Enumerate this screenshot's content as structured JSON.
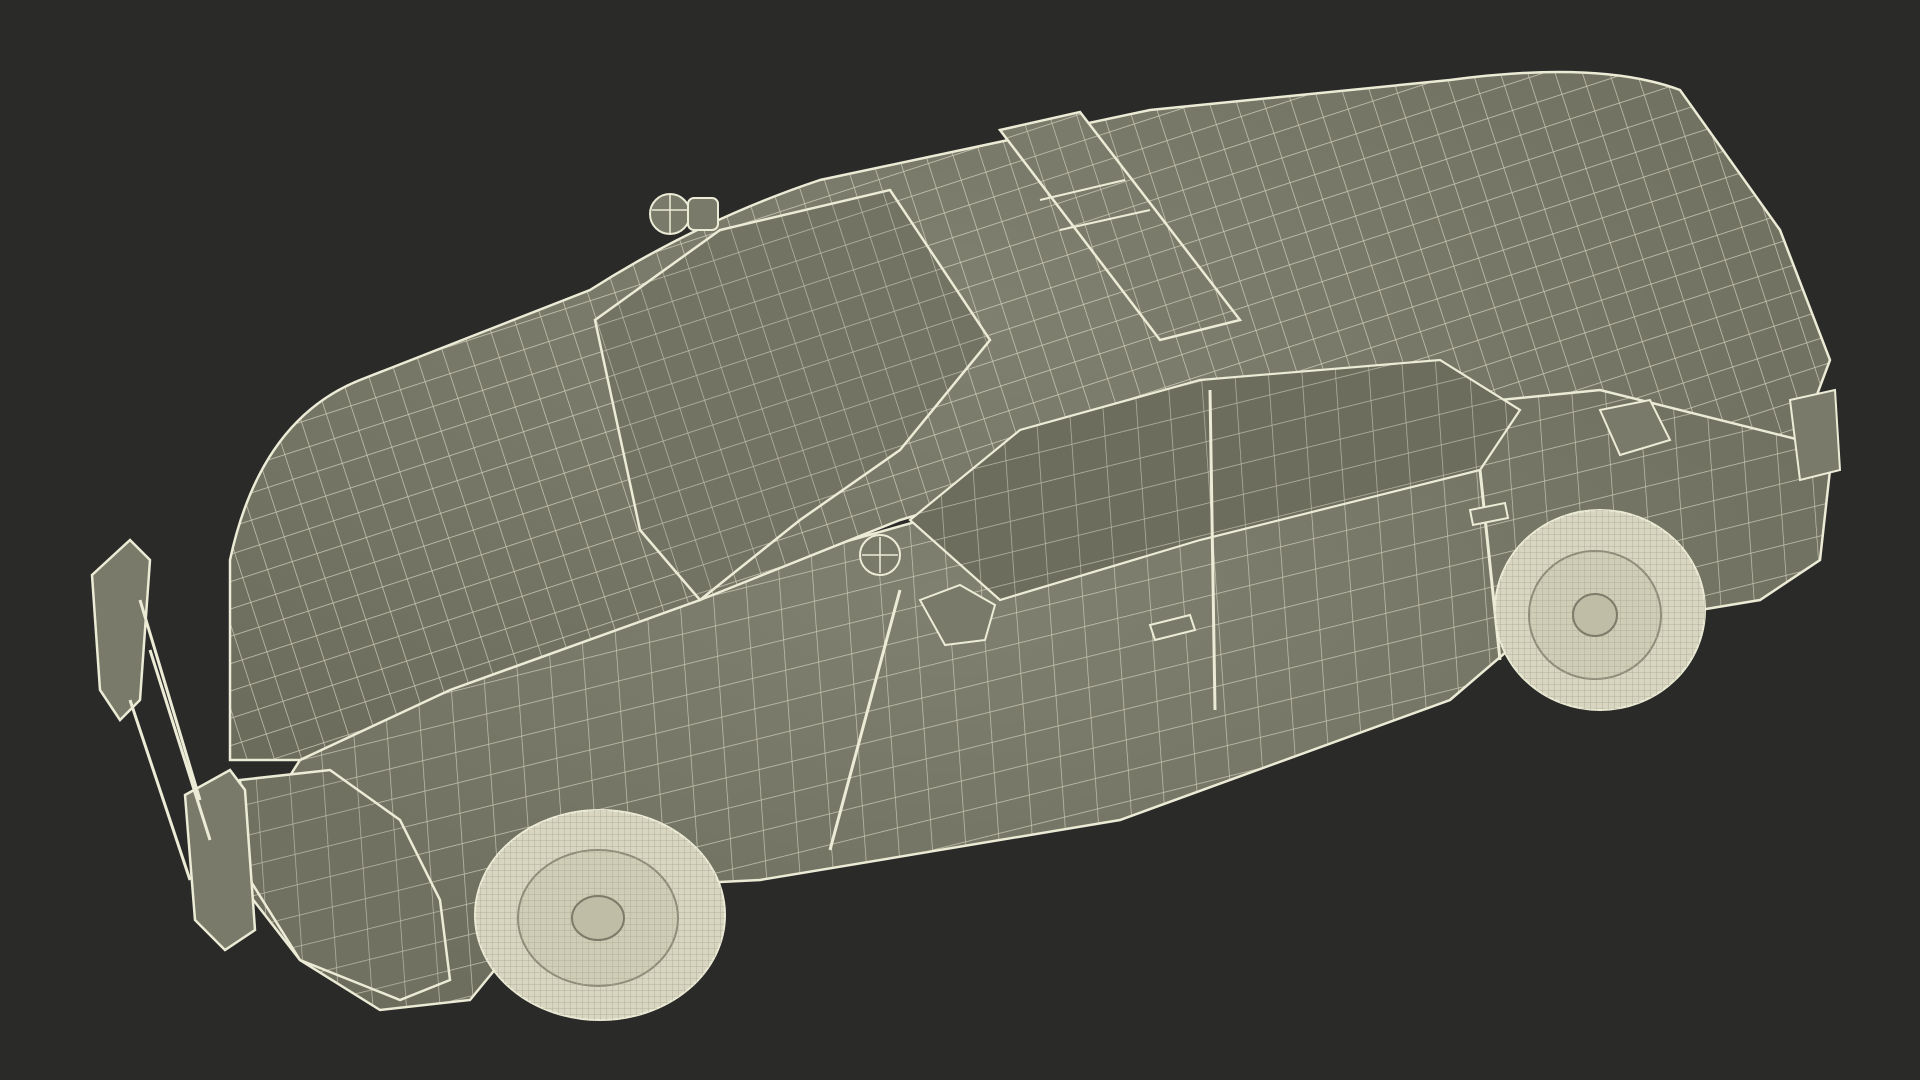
{
  "scene": {
    "background_color": "#2a2a29",
    "surface_color": "#7a7a6a",
    "surface_shadow_color": "#5f5f52",
    "wire_color": "#ecebd6",
    "tire_color": "#d9d7c2",
    "subject": "wireframe-police-car-model",
    "view": "isometric-top-front-left"
  }
}
